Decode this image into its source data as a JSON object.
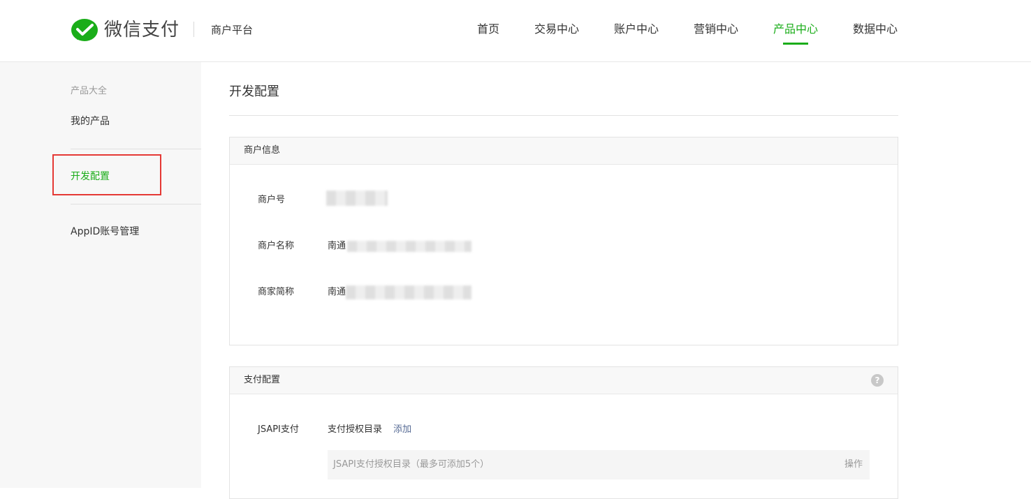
{
  "header": {
    "brand": "微信支付",
    "subtitle": "商户平台",
    "nav": [
      {
        "label": "首页"
      },
      {
        "label": "交易中心"
      },
      {
        "label": "账户中心"
      },
      {
        "label": "营销中心"
      },
      {
        "label": "产品中心",
        "active": true
      },
      {
        "label": "数据中心"
      }
    ],
    "accent_color": "#1aad19"
  },
  "sidebar": {
    "group_title": "产品大全",
    "items": [
      {
        "label": "我的产品"
      },
      {
        "label": "开发配置",
        "active": true
      },
      {
        "label": "AppID账号管理"
      }
    ]
  },
  "main": {
    "page_title": "开发配置",
    "merchant_panel": {
      "title": "商户信息",
      "fields": [
        {
          "label": "商户号",
          "value": ""
        },
        {
          "label": "商户名称",
          "value": "南通"
        },
        {
          "label": "商家简称",
          "value": "南通"
        }
      ]
    },
    "payment_panel": {
      "title": "支付配置",
      "help_icon": "question-circle-icon",
      "row_label": "JSAPI支付",
      "row_value": "支付授权目录",
      "add_link": "添加",
      "table_header": "JSAPI支付授权目录（最多可添加5个）",
      "table_action": "操作"
    }
  }
}
